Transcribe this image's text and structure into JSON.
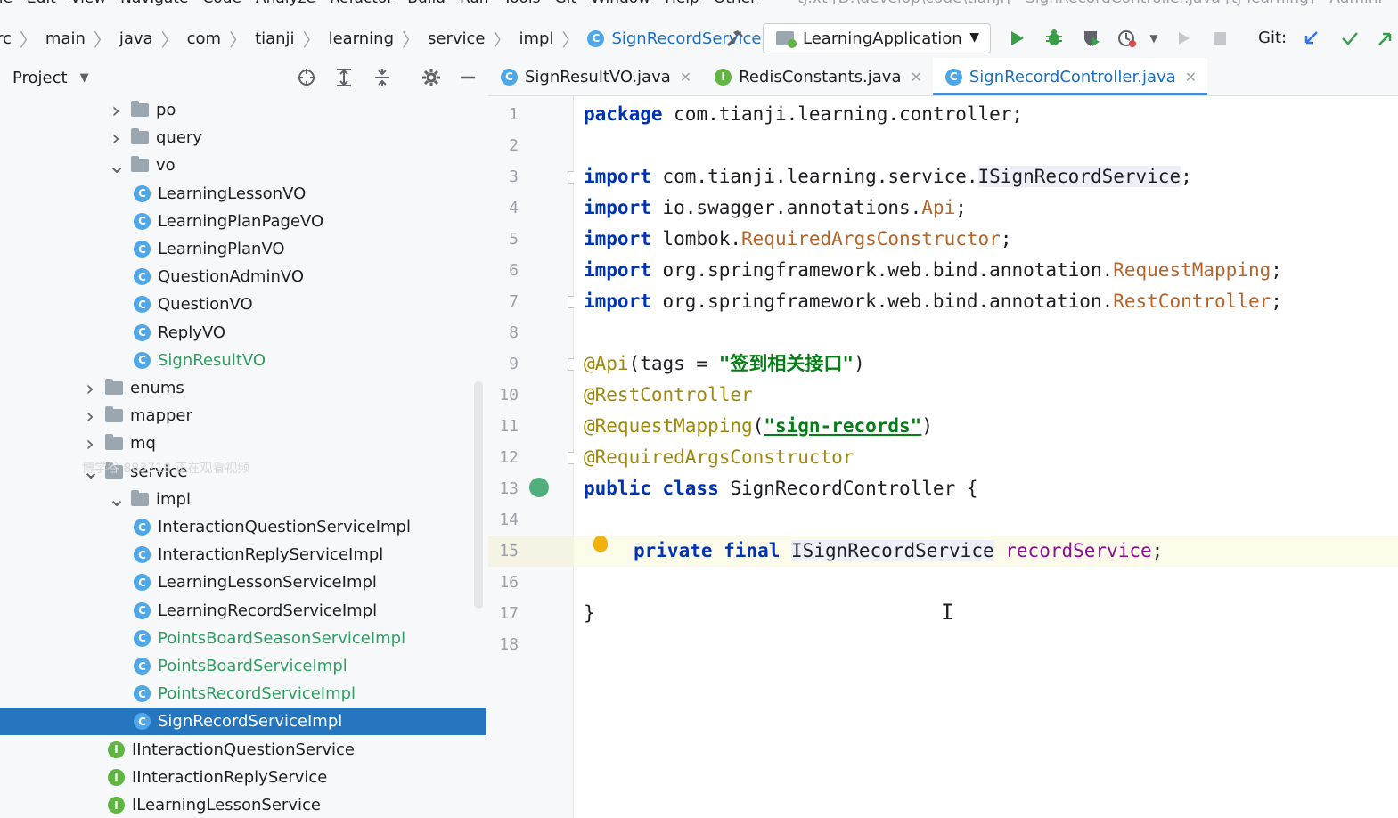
{
  "menu": {
    "items": [
      "ile",
      "Edit",
      "View",
      "Navigate",
      "Code",
      "Analyze",
      "Refactor",
      "Build",
      "Run",
      "Tools",
      "Git",
      "Window",
      "Help",
      "Other"
    ],
    "window_title": "tj.xt [D:\\develop\\code\\tianji] - SignRecordController.java [tj-learning] - Admini"
  },
  "breadcrumbs": [
    "rc",
    "main",
    "java",
    "com",
    "tianji",
    "learning",
    "service",
    "impl",
    "SignRecordServiceImpl"
  ],
  "run_config": "LearningApplication",
  "git_label": "Git:",
  "project_panel": {
    "title": "Project",
    "tree": [
      {
        "label": "po",
        "type": "folder",
        "expanded": false
      },
      {
        "label": "query",
        "type": "folder",
        "expanded": false
      },
      {
        "label": "vo",
        "type": "folder",
        "expanded": true
      },
      {
        "label": "LearningLessonVO",
        "type": "class"
      },
      {
        "label": "LearningPlanPageVO",
        "type": "class"
      },
      {
        "label": "LearningPlanVO",
        "type": "class"
      },
      {
        "label": "QuestionAdminVO",
        "type": "class"
      },
      {
        "label": "QuestionVO",
        "type": "class"
      },
      {
        "label": "ReplyVO",
        "type": "class"
      },
      {
        "label": "SignResultVO",
        "type": "class",
        "status": "new"
      },
      {
        "label": "enums",
        "type": "folder",
        "expanded": false
      },
      {
        "label": "mapper",
        "type": "folder",
        "expanded": false
      },
      {
        "label": "mq",
        "type": "folder",
        "expanded": false
      },
      {
        "label": "service",
        "type": "folder",
        "expanded": true
      },
      {
        "label": "impl",
        "type": "folder",
        "expanded": true
      },
      {
        "label": "InteractionQuestionServiceImpl",
        "type": "class"
      },
      {
        "label": "InteractionReplyServiceImpl",
        "type": "class"
      },
      {
        "label": "LearningLessonServiceImpl",
        "type": "class"
      },
      {
        "label": "LearningRecordServiceImpl",
        "type": "class"
      },
      {
        "label": "PointsBoardSeasonServiceImpl",
        "type": "class",
        "status": "new"
      },
      {
        "label": "PointsBoardServiceImpl",
        "type": "class",
        "status": "new"
      },
      {
        "label": "PointsRecordServiceImpl",
        "type": "class",
        "status": "new"
      },
      {
        "label": "SignRecordServiceImpl",
        "type": "class",
        "selected": true
      },
      {
        "label": "IInteractionQuestionService",
        "type": "interface"
      },
      {
        "label": "IInteractionReplyService",
        "type": "interface"
      },
      {
        "label": "ILearningLessonService",
        "type": "interface"
      }
    ],
    "watermark": "博学谷 883718 正在观看视频"
  },
  "tabs": [
    {
      "label": "SignResultVO.java",
      "kind": "class",
      "active": false
    },
    {
      "label": "RedisConstants.java",
      "kind": "interface",
      "active": false
    },
    {
      "label": "SignRecordController.java",
      "kind": "class",
      "active": true
    }
  ],
  "editor": {
    "line_numbers": [
      "1",
      "2",
      "3",
      "4",
      "5",
      "6",
      "7",
      "8",
      "9",
      "10",
      "11",
      "12",
      "13",
      "14",
      "15",
      "16",
      "17",
      "18"
    ],
    "current_line": 15,
    "code": {
      "l1_kw": "package",
      "l1_rest": " com.tianji.learning.controller;",
      "l3_kw": "import",
      "l3_a": " com.tianji.learning.service.",
      "l3_b": "ISignRecordService",
      "l3_c": ";",
      "l4_kw": "import",
      "l4_a": " io.swagger.annotations.",
      "l4_b": "Api",
      "l4_c": ";",
      "l5_kw": "import",
      "l5_a": " lombok.",
      "l5_b": "RequiredArgsConstructor",
      "l5_c": ";",
      "l6_kw": "import",
      "l6_a": " org.springframework.web.bind.annotation.",
      "l6_b": "RequestMapping",
      "l6_c": ";",
      "l7_kw": "import",
      "l7_a": " org.springframework.web.bind.annotation.",
      "l7_b": "RestController",
      "l7_c": ";",
      "l9_ann": "@Api",
      "l9_a": "(tags = ",
      "l9_str": "\"签到相关接口\"",
      "l9_c": ")",
      "l10_ann": "@RestController",
      "l11_ann": "@RequestMapping",
      "l11_a": "(",
      "l11_str": "\"sign-records\"",
      "l11_c": ")",
      "l12_ann": "@RequiredArgsConstructor",
      "l13_kw": "public class",
      "l13_rest": " SignRecordController {",
      "l15_kw": "private final",
      "l15_type": "ISignRecordService",
      "l15_field": "recordService",
      "l15_c": ";",
      "l17": "}"
    }
  }
}
